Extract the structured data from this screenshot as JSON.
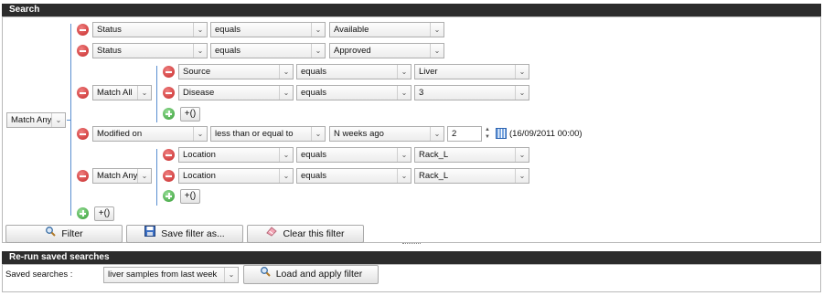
{
  "search": {
    "title": "Search",
    "root_logic": "Match Any",
    "rows": [
      {
        "field": "Status",
        "op": "equals",
        "value": "Available"
      },
      {
        "field": "Status",
        "op": "equals",
        "value": "Approved"
      }
    ],
    "group1": {
      "logic": "Match All",
      "rows": [
        {
          "field": "Source",
          "op": "equals",
          "value": "Liver"
        },
        {
          "field": "Disease",
          "op": "equals",
          "value": "3"
        }
      ],
      "add_label": "+()"
    },
    "modified": {
      "field": "Modified on",
      "op": "less than or equal to",
      "unit": "N weeks ago",
      "amount": "2",
      "date_text": "(16/09/2011 00:00)"
    },
    "group2": {
      "logic": "Match Any",
      "rows": [
        {
          "field": "Location",
          "op": "equals",
          "value": "Rack_L"
        },
        {
          "field": "Location",
          "op": "equals",
          "value": "Rack_L"
        }
      ],
      "add_label": "+()"
    },
    "root_add_label": "+()",
    "buttons": {
      "filter": "Filter",
      "save": "Save filter as...",
      "clear": "Clear this filter"
    }
  },
  "saved": {
    "title": "Re-run saved searches",
    "label": "Saved searches :",
    "selected": "liver samples from last week",
    "load_button": "Load and apply filter"
  }
}
